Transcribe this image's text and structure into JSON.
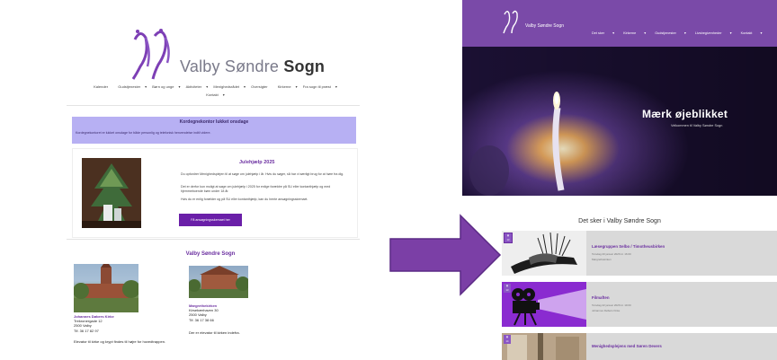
{
  "old_site": {
    "brand_light": "Valby Søndre ",
    "brand_bold": "Sogn",
    "nav": [
      "Kalender",
      "Gudstjenester",
      "Børn og unge",
      "Aktiviteter",
      "Menighedsrådet",
      "Oversigter",
      "Kirkerne",
      "Fra sogn til præst",
      "Kontakt"
    ],
    "notice": {
      "title": "Kordegnekontor lukket onsdage",
      "text": "Kordegnekontoret er lukket onsdage for både personlig og telefonisk henvendelse indtil videre."
    },
    "card": {
      "title": "Julehjælp 2025",
      "p1": "Du opfordrer Menighedsplejen til at søge om julehjælp i år. Hvis du søger, så har vi særligt brug for at høre fra dig.",
      "p2": "Det er derfor kun muligt at søge om julehjælp i 2025 for enlige forældre på SU eller kontanthjælp og med hjemmeboende børn under 18 år.",
      "p3": "Hvis du er enlig forælder og på SU eller kontanthjælp, kan du hente ansøgningsskemaet.",
      "button": "Få ansøgningsskemaet her"
    },
    "section_title": "Valby Søndre Sogn",
    "church1": {
      "name": "Johannes Døbers Kirke",
      "street": "Trekronergade 12",
      "city": "2500 Valby",
      "phone": "Tlf. 36 17 82 97",
      "note": "Elevator til kirke og krypt findes til højre for hovedtrappen."
    },
    "church2": {
      "name": "Margrethekirken",
      "street": "Kirsebærhaven 30",
      "city": "2500 Valby",
      "phone": "Tlf. 36 17 38 66",
      "note": "Der er elevator til kirken indefra."
    }
  },
  "new_site": {
    "brand": "Valby Søndre Sogn",
    "nav": [
      "Det sker",
      "Kirkerne",
      "Gudstjenester",
      "Livsbegivenheder",
      "Kontakt"
    ],
    "hero_title": "Mærk øjeblikket",
    "hero_subtitle": "Velkommen til Valby Søndre Sogn",
    "events_title": "Det sker i Valby Søndre Sogn",
    "events": [
      {
        "date": "13",
        "name": "Læsegruppen Selbo / Timotheusbirken",
        "meta1": "Torsdag 20 januar 2026 kl. 16:00",
        "meta2": "Margrethekirken"
      },
      {
        "date": "13",
        "name": "Filmaften",
        "meta1": "Torsdag 22 januar 2026 kl. 19:00",
        "meta2": "Johannes Døbers Kirke"
      },
      {
        "date": "14",
        "name": "Menighedsplejens med Søren Devers",
        "meta1": "",
        "meta2": ""
      }
    ]
  },
  "colors": {
    "purple": "#6b2fa0",
    "notice": "#b7b0f3",
    "topbar": "#7a4aa8",
    "arrow": "#7b3fa6",
    "button": "#6a1fa8"
  }
}
